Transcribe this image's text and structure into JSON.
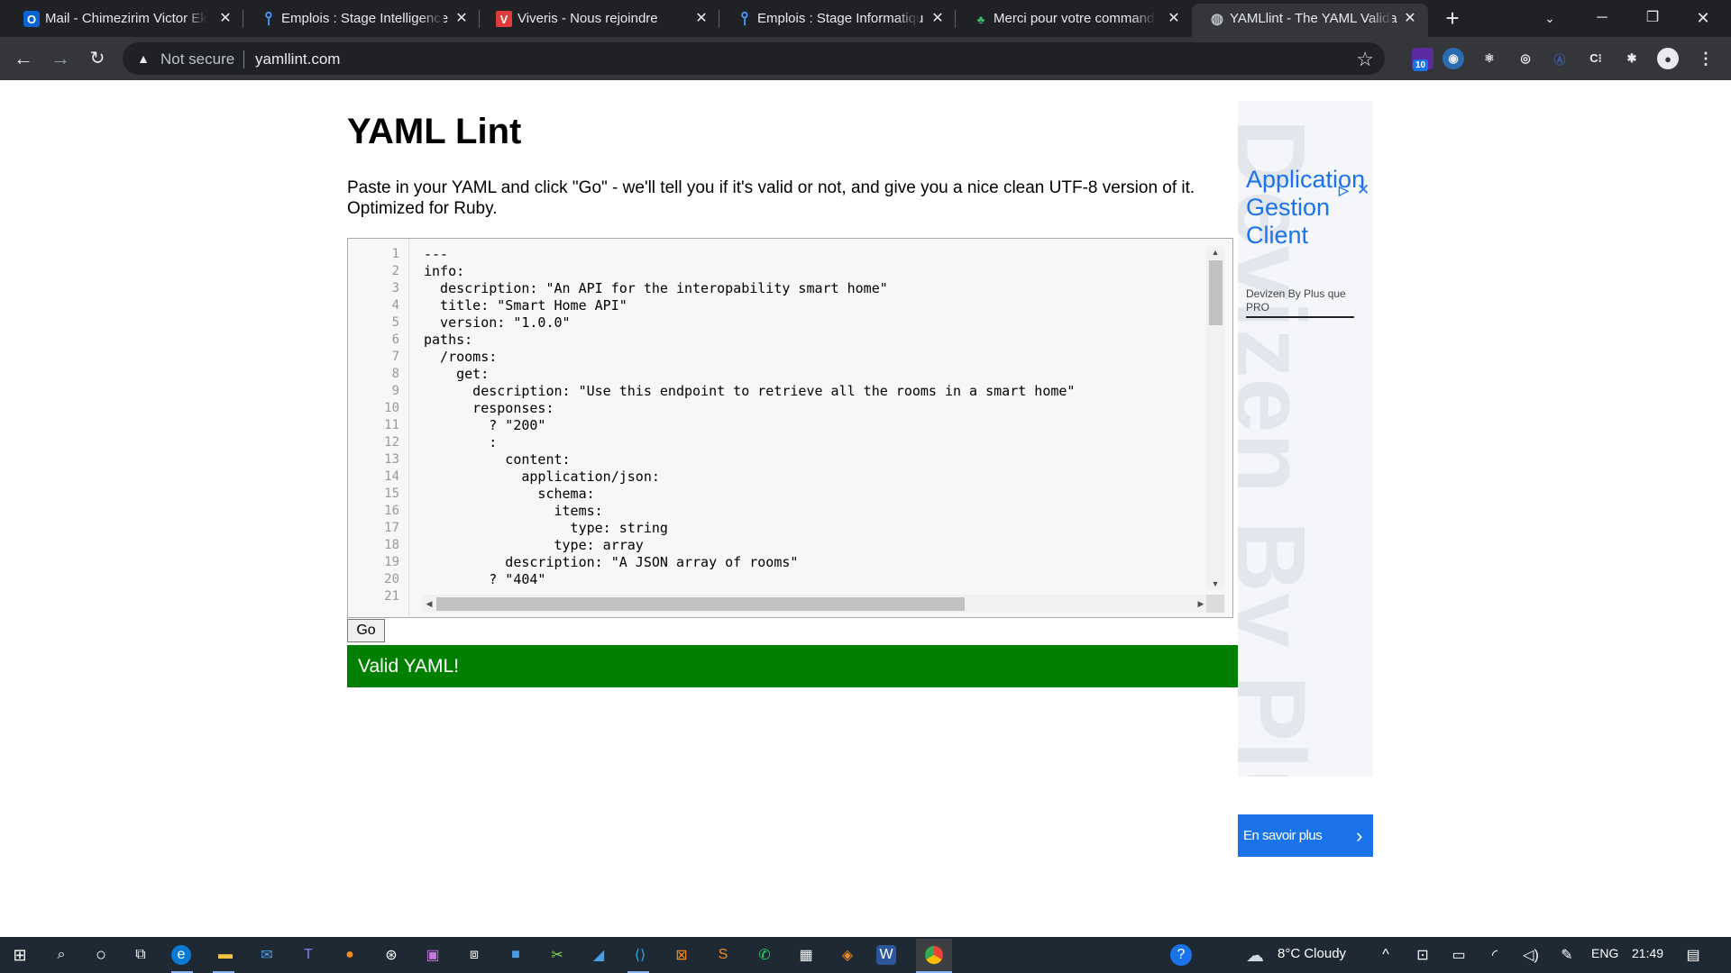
{
  "browser": {
    "tabs": [
      {
        "title": "Mail - Chimezirim Victor Ek",
        "icon": "outlook-icon",
        "active": false
      },
      {
        "title": "Emplois : Stage Intelligence",
        "icon": "job-board-icon",
        "active": false
      },
      {
        "title": "Viveris - Nous rejoindre",
        "icon": "viveris-icon",
        "active": false
      },
      {
        "title": "Emplois : Stage Informatiqu",
        "icon": "job-board-icon",
        "active": false
      },
      {
        "title": "Merci pour votre command",
        "icon": "shop-icon",
        "active": false
      },
      {
        "title": "YAMLlint - The YAML Valida",
        "icon": "globe-icon",
        "active": true
      }
    ],
    "omnibox": {
      "security_label": "Not secure",
      "url": "yamllint.com"
    },
    "extension_badge": "10"
  },
  "page": {
    "title": "YAML Lint",
    "intro": "Paste in your YAML and click \"Go\" - we'll tell you if it's valid or not, and give you a nice clean UTF-8 version of it. Optimized for Ruby.",
    "go_label": "Go",
    "result": "Valid YAML!",
    "result_color": "#008000",
    "editor_lines": [
      "---",
      "info:",
      "  description: \"An API for the interopability smart home\"",
      "  title: \"Smart Home API\"",
      "  version: \"1.0.0\"",
      "paths:",
      "  /rooms:",
      "    get:",
      "      description: \"Use this endpoint to retrieve all the rooms in a smart home\"",
      "      responses:",
      "        ? \"200\"",
      "        :",
      "          content:",
      "            application/json:",
      "              schema:",
      "                items:",
      "                  type: string",
      "                type: array",
      "          description: \"A JSON array of rooms\"",
      "        ? \"404\"",
      ""
    ],
    "line_numbers": [
      "1",
      "2",
      "3",
      "4",
      "5",
      "6",
      "7",
      "8",
      "9",
      "10",
      "11",
      "12",
      "13",
      "14",
      "15",
      "16",
      "17",
      "18",
      "19",
      "20",
      "21"
    ]
  },
  "ad": {
    "headline": "Application Gestion Client",
    "advertiser": "Devizen By Plus que PRO",
    "background_text": "Devizen By Plus",
    "cta": "En savoir plus"
  },
  "taskbar": {
    "weather": "8°C  Cloudy",
    "language": "ENG",
    "time": "21:49"
  }
}
